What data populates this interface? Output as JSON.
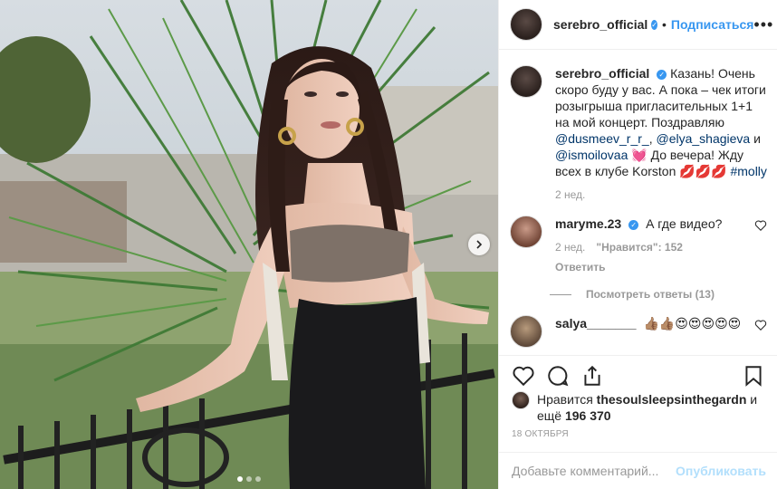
{
  "post": {
    "username": "serebro_official",
    "follow_label": "Подписаться",
    "more_icon": "more-horizontal-icon",
    "caption_parts": {
      "text1": "Казань! Очень скоро буду у вас. А пока – чек итоги розыгрыша пригласительных 1+1 на мой концерт. Поздравляю ",
      "mention1": "@dusmeev_r_r_",
      "sep1": ", ",
      "mention2": "@elya_shagieva",
      "sep2": " и ",
      "mention3": "@ismoilovaa",
      "text2": " 💓 До вечера! Жду всех в клубе Korston 💋💋💋 ",
      "hashtag": "#molly"
    },
    "caption_time": "2 нед."
  },
  "comments": [
    {
      "username": "maryme.23",
      "verified": true,
      "text": "А где видео?",
      "time": "2 нед.",
      "likes_label": "\"Нравится\": 152",
      "reply_label": "Ответить",
      "view_replies": "Посмотреть ответы (13)"
    },
    {
      "username": "salya_______",
      "verified": false,
      "text": "👍🏽👍🏽😍😍😍😍😍"
    }
  ],
  "actions": {
    "icons": [
      "heart-icon",
      "comment-icon",
      "share-icon",
      "bookmark-icon"
    ]
  },
  "likes": {
    "prefix": "Нравится",
    "liker": "thesoulsleepsinthegardn",
    "and_more": "и ещё",
    "count": "196 370"
  },
  "date": "18 ОКТЯБРЯ",
  "add_comment": {
    "placeholder": "Добавьте комментарий...",
    "publish_label": "Опубликовать"
  },
  "carousel": {
    "slides": 3,
    "active": 1
  },
  "colors": {
    "link": "#003569",
    "accent": "#3897f0",
    "muted": "#999999",
    "publish_disabled": "#b2dffc"
  }
}
